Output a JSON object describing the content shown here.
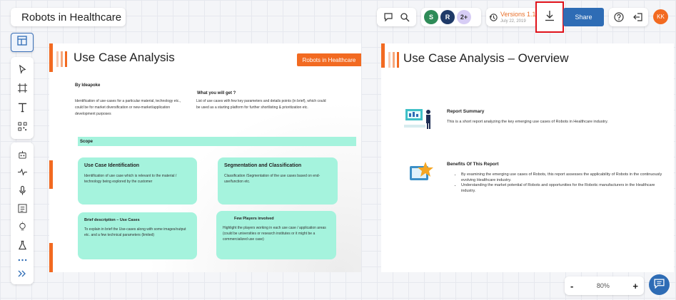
{
  "app": {
    "title": "Robots in Healthcare"
  },
  "header": {
    "avatars": [
      {
        "initial": "S",
        "color": "#2e8b57"
      },
      {
        "initial": "R",
        "color": "#1f3a68"
      },
      {
        "initial": "2+",
        "color": "#d7cdf5"
      }
    ],
    "version_label": "Versions 1.1",
    "version_date": "July 22, 2019",
    "share_label": "Share",
    "user_initials": "KK"
  },
  "toolbar": {
    "tools": [
      "layout-icon",
      "pointer-icon",
      "frame-icon",
      "text-icon",
      "qr-icon",
      "robot-icon",
      "pulse-icon",
      "mic-icon",
      "report-icon",
      "bulb-icon",
      "flask-icon",
      "more-icon",
      "expand-icon"
    ]
  },
  "slide1": {
    "title": "Use Case Analysis",
    "tag": "Robots in Healthcare",
    "by": "By Ideapoke",
    "intro": "Identification of use-cases for a particular material, technology etc., could be for market diversification or new-market/application development purposes",
    "get_title": "What you will get ?",
    "get_text": "List of use cases with few key parameters and details points (in brief), which could be used as a starting platform for further shortlisting & prioritization etc.",
    "scope": "Scope",
    "boxes": [
      {
        "title": "Use Case Identification",
        "text": "Identification of use case which is relevant to the material / technology being explored by the customer"
      },
      {
        "title": "Segmentation and Classification",
        "text": "Classification /Segmentation of the use cases based on end-use/function etc."
      },
      {
        "title": "Brief description – Use Cases",
        "text": "To explain in brief the Use-cases along with some images/output etc. and a few technical parameters (limited)"
      },
      {
        "title": "Few Players involved",
        "text": "Highlight the players working in each use case / application areas (could be universities or research institutes or it might be a commercialized use case)"
      }
    ]
  },
  "slide2": {
    "title": "Use Case Analysis – Overview",
    "summary_title": "Report Summary",
    "summary_text": "This is a short report analyzing the key emerging use cases of Robots in Healthcare industry.",
    "benefits_title": "Benefits Of This Report",
    "benefits": [
      "By examining the emerging use cases of Robots, this report assesses the applicability of Robots in the continuously evolving Healthcare industry.",
      "Understanding the market potential of Robots and opportunities for the Robotic manufacturers in the Healthcare industry."
    ]
  },
  "zoom": {
    "minus": "-",
    "value": "80%",
    "plus": "+"
  }
}
